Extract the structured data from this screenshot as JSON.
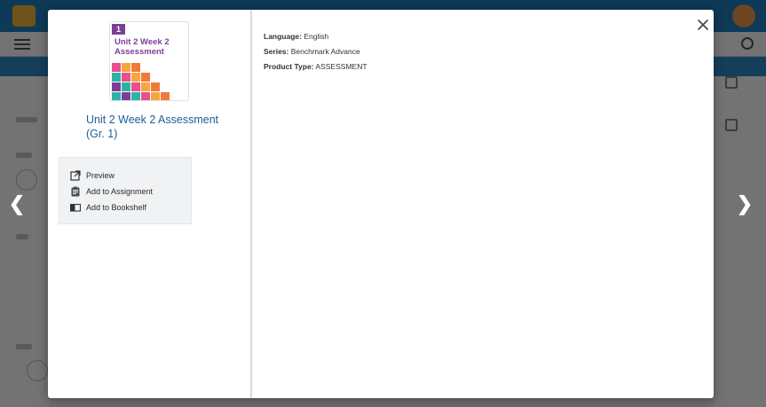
{
  "modal": {
    "product_title": "Unit 2 Week 2 Assessment (Gr. 1)",
    "cover": {
      "badge": "1",
      "title": "Unit 2 Week 2 Assessment"
    },
    "actions": [
      {
        "label": "Preview",
        "icon": "external-link-icon"
      },
      {
        "label": "Add to Assignment",
        "icon": "assignment-icon"
      },
      {
        "label": "Add to Bookshelf",
        "icon": "bookshelf-icon"
      }
    ],
    "details": {
      "language_label": "Language:",
      "language_value": "English",
      "series_label": "Series:",
      "series_value": "Benchmark Advance",
      "product_type_label": "Product Type:",
      "product_type_value": "ASSESSMENT"
    }
  },
  "colors": {
    "title_blue": "#1d5d96",
    "cover_purple": "#7b3f98",
    "overlay": "rgba(0,0,0,0.55)"
  }
}
